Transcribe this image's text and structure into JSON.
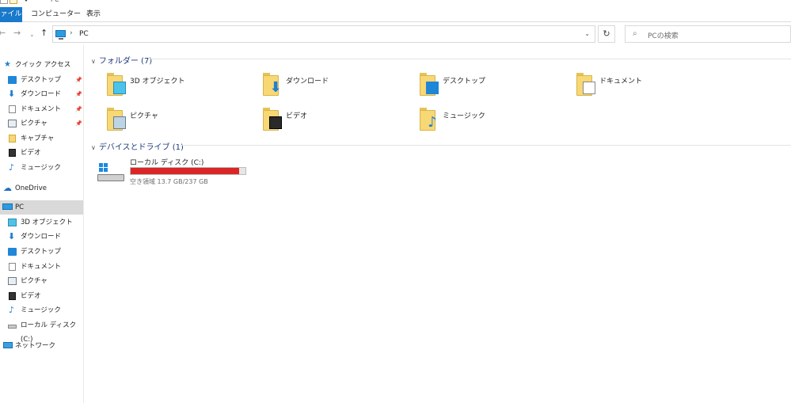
{
  "window": {
    "title_fragment": "PC"
  },
  "ribbon": {
    "tabs": [
      {
        "label": "ァイル",
        "selected": true
      },
      {
        "label": "コンピューター",
        "selected": false
      },
      {
        "label": "表示",
        "selected": false
      }
    ]
  },
  "navigation": {
    "back": "←",
    "forward": "→",
    "recent": "⌄",
    "up": "↑",
    "address_separator": "›",
    "address_text": "PC",
    "address_dropdown": "⌄",
    "refresh": "↻",
    "search_icon": "⌕",
    "search_placeholder": "PCの検索"
  },
  "sidebar": {
    "items": [
      {
        "label": "クイック アクセス",
        "icon": "star-icon",
        "pinned": false
      },
      {
        "label": "デスクトップ",
        "icon": "desktop-icon",
        "pinned": true
      },
      {
        "label": "ダウンロード",
        "icon": "download-icon",
        "pinned": true
      },
      {
        "label": "ドキュメント",
        "icon": "document-icon",
        "pinned": true
      },
      {
        "label": "ピクチャ",
        "icon": "pictures-icon",
        "pinned": true
      },
      {
        "label": "キャプチャ",
        "icon": "folder-icon",
        "pinned": false
      },
      {
        "label": "ビデオ",
        "icon": "video-icon",
        "pinned": false
      },
      {
        "label": "ミュージック",
        "icon": "music-icon",
        "pinned": false
      },
      {
        "label": "OneDrive",
        "icon": "cloud-icon",
        "pinned": false
      },
      {
        "label": "PC",
        "icon": "pc-icon",
        "pinned": false,
        "selected": true
      },
      {
        "label": "3D オブジェクト",
        "icon": "3d-objects-icon",
        "pinned": false
      },
      {
        "label": "ダウンロード",
        "icon": "download-icon",
        "pinned": false
      },
      {
        "label": "デスクトップ",
        "icon": "desktop-icon",
        "pinned": false
      },
      {
        "label": "ドキュメント",
        "icon": "document-icon",
        "pinned": false
      },
      {
        "label": "ピクチャ",
        "icon": "pictures-icon",
        "pinned": false
      },
      {
        "label": "ビデオ",
        "icon": "video-icon",
        "pinned": false
      },
      {
        "label": "ミュージック",
        "icon": "music-icon",
        "pinned": false
      },
      {
        "label": "ローカル ディスク (C:)",
        "icon": "drive-icon",
        "pinned": false
      },
      {
        "label": "ネットワーク",
        "icon": "network-icon",
        "pinned": false
      }
    ],
    "pin_glyph": "📌"
  },
  "main": {
    "folders_group": {
      "title": "フォルダー (7)",
      "chevron": "∨",
      "items": [
        {
          "label": "3D オブジェクト",
          "badge": "3d"
        },
        {
          "label": "ダウンロード",
          "badge": "down"
        },
        {
          "label": "デスクトップ",
          "badge": "desk"
        },
        {
          "label": "ドキュメント",
          "badge": "doc"
        },
        {
          "label": "ピクチャ",
          "badge": "pic"
        },
        {
          "label": "ビデオ",
          "badge": "vid"
        },
        {
          "label": "ミュージック",
          "badge": "music"
        }
      ]
    },
    "drives_group": {
      "title": "デバイスとドライブ (1)",
      "chevron": "∨",
      "drive": {
        "name": "ローカル ディスク (C:)",
        "free_text": "空き領域 13.7 GB/237 GB",
        "used_fraction": 0.942,
        "bar_color": "#da2626"
      }
    }
  },
  "colors": {
    "accent": "#1979ca",
    "selected_nav": "#d9d9d9",
    "folder_yellow": "#f8d775"
  }
}
